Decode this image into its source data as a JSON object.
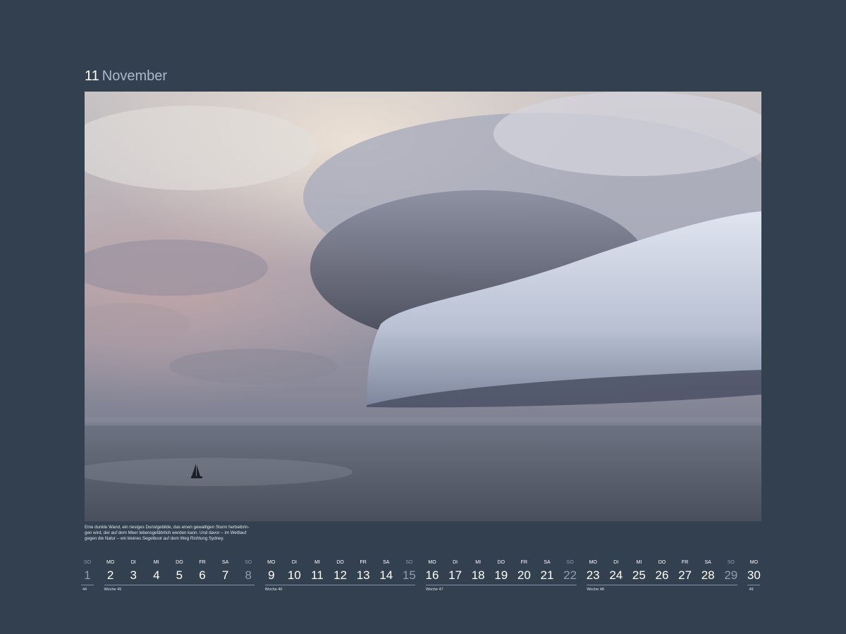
{
  "header": {
    "month_number": "11",
    "month_name": "November"
  },
  "caption": {
    "lines": [
      "Eine dunkle Wand, ein riesiges Dunstgebilde, das einen gewaltigen Sturm herbeibrin-",
      "gen wird, der auf dem Meer lebensgefährlich werden kann. Und davor – im Wettlauf",
      "gegen die Natur – ein kleines Segelboot auf dem Weg Richtung Sydney."
    ]
  },
  "calendar": {
    "days": [
      {
        "abbr": "SO",
        "num": "1",
        "sunday": true
      },
      {
        "abbr": "MO",
        "num": "2",
        "sunday": false
      },
      {
        "abbr": "DI",
        "num": "3",
        "sunday": false
      },
      {
        "abbr": "MI",
        "num": "4",
        "sunday": false
      },
      {
        "abbr": "DO",
        "num": "5",
        "sunday": false
      },
      {
        "abbr": "FR",
        "num": "6",
        "sunday": false
      },
      {
        "abbr": "SA",
        "num": "7",
        "sunday": false
      },
      {
        "abbr": "SO",
        "num": "8",
        "sunday": true
      },
      {
        "abbr": "MO",
        "num": "9",
        "sunday": false
      },
      {
        "abbr": "DI",
        "num": "10",
        "sunday": false
      },
      {
        "abbr": "MI",
        "num": "11",
        "sunday": false
      },
      {
        "abbr": "DO",
        "num": "12",
        "sunday": false
      },
      {
        "abbr": "FR",
        "num": "13",
        "sunday": false
      },
      {
        "abbr": "SA",
        "num": "14",
        "sunday": false
      },
      {
        "abbr": "SO",
        "num": "15",
        "sunday": true
      },
      {
        "abbr": "MO",
        "num": "16",
        "sunday": false
      },
      {
        "abbr": "DI",
        "num": "17",
        "sunday": false
      },
      {
        "abbr": "MI",
        "num": "18",
        "sunday": false
      },
      {
        "abbr": "DO",
        "num": "19",
        "sunday": false
      },
      {
        "abbr": "FR",
        "num": "20",
        "sunday": false
      },
      {
        "abbr": "SA",
        "num": "21",
        "sunday": false
      },
      {
        "abbr": "SO",
        "num": "22",
        "sunday": true
      },
      {
        "abbr": "MO",
        "num": "23",
        "sunday": false
      },
      {
        "abbr": "DI",
        "num": "24",
        "sunday": false
      },
      {
        "abbr": "MI",
        "num": "25",
        "sunday": false
      },
      {
        "abbr": "DO",
        "num": "26",
        "sunday": false
      },
      {
        "abbr": "FR",
        "num": "27",
        "sunday": false
      },
      {
        "abbr": "SA",
        "num": "28",
        "sunday": false
      },
      {
        "abbr": "SO",
        "num": "29",
        "sunday": true
      },
      {
        "abbr": "MO",
        "num": "30",
        "sunday": false
      }
    ],
    "weeks": [
      {
        "label": "44"
      },
      {
        "label": "Woche 45"
      },
      {
        "label": "Woche 46"
      },
      {
        "label": "Woche 47"
      },
      {
        "label": "Woche 48"
      },
      {
        "label": "49"
      }
    ]
  },
  "colors": {
    "background": "#33404f",
    "weekday_text": "#ffffff",
    "sunday_text": "#8e9db1",
    "month_name": "#a9b8cc"
  }
}
